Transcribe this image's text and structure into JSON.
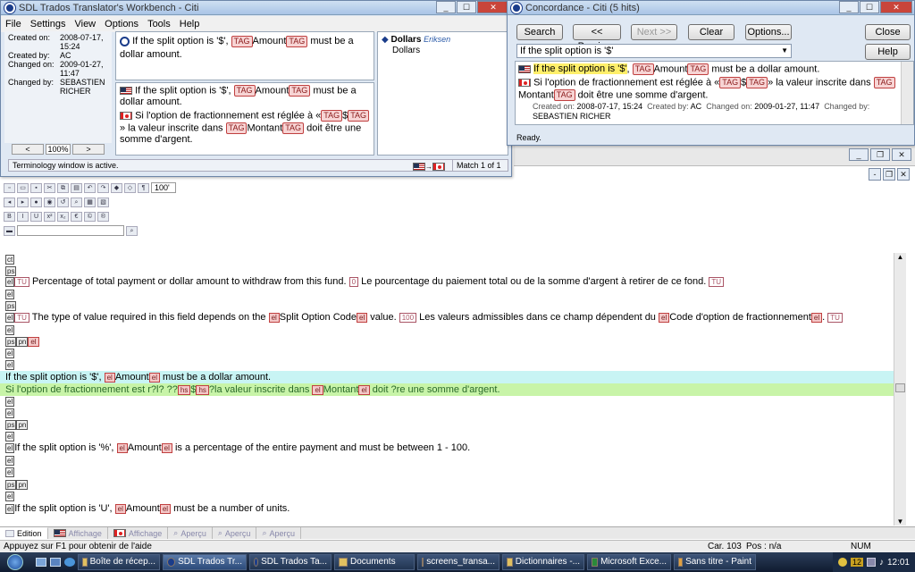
{
  "workbench": {
    "title": "SDL Trados Translator's Workbench - Citi",
    "menu": [
      "File",
      "Settings",
      "View",
      "Options",
      "Tools",
      "Help"
    ],
    "meta": {
      "created_on_label": "Created on:",
      "created_on": "2008-07-17, 15:24",
      "created_by_label": "Created by:",
      "created_by": "AC",
      "changed_on_label": "Changed on:",
      "changed_on": "2009-01-27, 11:47",
      "changed_by_label": "Changed by:",
      "changed_by": "SEBASTIEN RICHER"
    },
    "zoom": "100%",
    "source_segment": {
      "pre": "If the split option is '$', ",
      "tag1": "TAG",
      "mid": "Amount",
      "tag2": "TAG",
      "post": " must be a dollar amount."
    },
    "match_source": {
      "pre": "If the split option is '$', ",
      "tag1": "TAG",
      "mid": "Amount",
      "tag2": "TAG",
      "post": " must be a dollar amount."
    },
    "match_target": {
      "pre": "Si l'option de fractionnement est réglée à «",
      "tag1": "TAG",
      "mid1": "$",
      "tag2": "TAG",
      "mid2": "» la valeur inscrite dans ",
      "tag3": "TAG",
      "mid3": "Montant",
      "tag4": "TAG",
      "post": " doit être une somme d'argent."
    },
    "term": {
      "source": "Dollars",
      "author": "Eriksen",
      "target": "Dollars"
    },
    "status": "Terminology window is active.",
    "match_count": "Match 1 of 1"
  },
  "concordance": {
    "title": "Concordance - Citi (5 hits)",
    "buttons": {
      "search": "Search",
      "previous": "<< Previous",
      "next": "Next >>",
      "clear": "Clear",
      "options": "Options...",
      "close": "Close",
      "help": "Help"
    },
    "query": "If the split option is '$'",
    "hit_source": {
      "highlight": "If the split option is '$'",
      "rest": ", ",
      "tag1": "TAG",
      "mid": "Amount",
      "tag2": "TAG",
      "post": " must be a dollar amount."
    },
    "hit_target": {
      "pre": "Si l'option de fractionnement est réglée à «",
      "tag1": "TAG",
      "mid1": "$",
      "tag2": "TAG",
      "mid2": "» la valeur inscrite dans ",
      "tag3": "TAG",
      "mid3": "Montant",
      "tag4": "TAG",
      "post": " doit être une somme d'argent."
    },
    "hit_meta": {
      "created_on_label": "Created on:",
      "created_on": "2008-07-17, 15:24",
      "created_by_label": "Created by:",
      "created_by": "AC",
      "changed_on_label": "Changed on:",
      "changed_on": "2009-01-27, 11:47",
      "changed_by_label": "Changed by:",
      "changed_by": "SEBASTIEN RICHER"
    },
    "status": "Ready."
  },
  "editor": {
    "zoom": "100'",
    "markers": {
      "ct": "ct",
      "ps": "ps",
      "el": "el",
      "pn": "pn",
      "tu": "TU",
      "zero": "0",
      "hundred": "100",
      "hs": "hs"
    },
    "line1": {
      "src": "Percentage of total payment or dollar amount to withdraw from this fund.",
      "tgt": "Le pourcentage du paiement total ou de la somme d'argent à retirer de ce fond."
    },
    "line2": {
      "src_a": "The type of value required in this field depends on the ",
      "src_b": "Split Option Code",
      "src_c": " value.",
      "tgt_a": "Les valeurs admissibles dans ce champ dépendent du ",
      "tgt_b": "Code d'option de fractionnement",
      "tgt_c": "."
    },
    "active_src": {
      "a": "If the split option is '$', ",
      "b": "Amount",
      "c": " must be a dollar amount."
    },
    "active_tgt": {
      "a": "Si l'option de fractionnement est r?l? ??",
      "b": "$",
      "c": "?la valeur inscrite dans ",
      "d": "Montant",
      "e": " doit ?re une somme d'argent."
    },
    "line4": {
      "a": "If the split option is '%', ",
      "b": "Amount",
      "c": " is a percentage of the entire payment and must be between 1 - 100."
    },
    "line5": {
      "a": "If the split option is 'U', ",
      "b": "Amount",
      "c": " must be a number of units."
    }
  },
  "tabs": [
    "Edition",
    "Affichage",
    "Affichage",
    "Aperçu",
    "Aperçu",
    "Aperçu"
  ],
  "statusbar": {
    "help": "Appuyez sur F1 pour obtenir de l'aide",
    "car": "Car. 103",
    "pos": "Pos : n/a",
    "num": "NUM"
  },
  "taskbar": {
    "items": [
      "Boîte de récep...",
      "SDL Trados Tr...",
      "SDL Trados Ta...",
      "Documents",
      "screens_transa...",
      "Dictionnaires -...",
      "Microsoft Exce...",
      "Sans titre - Paint"
    ],
    "badge": "12",
    "clock": "12:01"
  }
}
